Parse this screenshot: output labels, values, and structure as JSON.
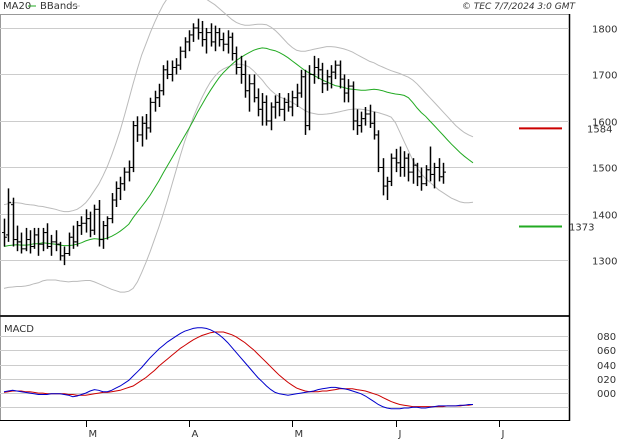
{
  "header": {
    "legend_ma": "MA20",
    "legend_bb": "BBands",
    "source_line": "© TEC 7/7/2024 3:0 GMT"
  },
  "colors": {
    "price_bar": "#000000",
    "ma": "#22aa22",
    "bbands": "#bbbbbb",
    "resistance": "#cc0000",
    "support": "#22aa22",
    "macd": "#0000cc",
    "signal": "#cc0000",
    "grid": "#cccccc"
  },
  "chart_data": [
    {
      "type": "ohlc",
      "title": "",
      "y_ticks": [
        1300,
        1400,
        1500,
        1600,
        1700,
        1800
      ],
      "y_range": [
        1215,
        1830
      ],
      "x_month_labels": [
        "M",
        "A",
        "M",
        "J",
        "J"
      ],
      "x_month_positions": [
        19,
        43,
        67,
        91,
        115
      ],
      "series_count": 120,
      "resistance_level": 1584,
      "support_level": 1373,
      "bars": [
        [
          1360,
          1390,
          1330,
          1350
        ],
        [
          1355,
          1455,
          1340,
          1425
        ],
        [
          1420,
          1435,
          1330,
          1345
        ],
        [
          1345,
          1375,
          1320,
          1340
        ],
        [
          1340,
          1360,
          1315,
          1325
        ],
        [
          1325,
          1370,
          1320,
          1345
        ],
        [
          1345,
          1365,
          1315,
          1330
        ],
        [
          1330,
          1370,
          1325,
          1355
        ],
        [
          1355,
          1370,
          1310,
          1335
        ],
        [
          1335,
          1370,
          1320,
          1360
        ],
        [
          1360,
          1380,
          1325,
          1330
        ],
        [
          1330,
          1355,
          1310,
          1340
        ],
        [
          1340,
          1365,
          1320,
          1335
        ],
        [
          1335,
          1340,
          1300,
          1310
        ],
        [
          1310,
          1330,
          1290,
          1315
        ],
        [
          1315,
          1360,
          1310,
          1350
        ],
        [
          1350,
          1375,
          1325,
          1340
        ],
        [
          1340,
          1385,
          1330,
          1375
        ],
        [
          1375,
          1395,
          1355,
          1380
        ],
        [
          1380,
          1410,
          1360,
          1390
        ],
        [
          1390,
          1405,
          1350,
          1365
        ],
        [
          1365,
          1420,
          1355,
          1410
        ],
        [
          1410,
          1430,
          1330,
          1345
        ],
        [
          1345,
          1385,
          1325,
          1375
        ],
        [
          1375,
          1395,
          1345,
          1390
        ],
        [
          1390,
          1445,
          1380,
          1430
        ],
        [
          1430,
          1470,
          1415,
          1455
        ],
        [
          1455,
          1480,
          1430,
          1465
        ],
        [
          1465,
          1500,
          1450,
          1490
        ],
        [
          1490,
          1515,
          1470,
          1500
        ],
        [
          1500,
          1600,
          1490,
          1590
        ],
        [
          1590,
          1610,
          1555,
          1570
        ],
        [
          1570,
          1610,
          1545,
          1595
        ],
        [
          1595,
          1615,
          1560,
          1585
        ],
        [
          1585,
          1650,
          1575,
          1640
        ],
        [
          1640,
          1665,
          1620,
          1650
        ],
        [
          1650,
          1680,
          1630,
          1665
        ],
        [
          1665,
          1720,
          1655,
          1710
        ],
        [
          1710,
          1730,
          1690,
          1700
        ],
        [
          1700,
          1730,
          1685,
          1715
        ],
        [
          1715,
          1735,
          1700,
          1720
        ],
        [
          1720,
          1760,
          1710,
          1750
        ],
        [
          1750,
          1780,
          1735,
          1770
        ],
        [
          1770,
          1795,
          1750,
          1785
        ],
        [
          1785,
          1810,
          1770,
          1800
        ],
        [
          1800,
          1820,
          1775,
          1790
        ],
        [
          1790,
          1815,
          1760,
          1775
        ],
        [
          1775,
          1800,
          1745,
          1790
        ],
        [
          1790,
          1810,
          1760,
          1770
        ],
        [
          1770,
          1805,
          1750,
          1790
        ],
        [
          1790,
          1800,
          1760,
          1775
        ],
        [
          1775,
          1790,
          1750,
          1765
        ],
        [
          1765,
          1795,
          1745,
          1780
        ],
        [
          1780,
          1790,
          1730,
          1745
        ],
        [
          1745,
          1760,
          1700,
          1715
        ],
        [
          1715,
          1740,
          1680,
          1700
        ],
        [
          1700,
          1730,
          1650,
          1665
        ],
        [
          1665,
          1700,
          1620,
          1680
        ],
        [
          1680,
          1700,
          1640,
          1650
        ],
        [
          1650,
          1670,
          1610,
          1625
        ],
        [
          1625,
          1660,
          1590,
          1640
        ],
        [
          1640,
          1655,
          1590,
          1600
        ],
        [
          1600,
          1640,
          1580,
          1630
        ],
        [
          1630,
          1655,
          1605,
          1640
        ],
        [
          1640,
          1660,
          1610,
          1625
        ],
        [
          1625,
          1650,
          1600,
          1640
        ],
        [
          1640,
          1660,
          1620,
          1630
        ],
        [
          1630,
          1665,
          1610,
          1650
        ],
        [
          1650,
          1680,
          1630,
          1660
        ],
        [
          1660,
          1710,
          1650,
          1695
        ],
        [
          1695,
          1710,
          1570,
          1590
        ],
        [
          1590,
          1720,
          1580,
          1700
        ],
        [
          1700,
          1740,
          1680,
          1715
        ],
        [
          1715,
          1735,
          1690,
          1710
        ],
        [
          1710,
          1725,
          1660,
          1680
        ],
        [
          1680,
          1710,
          1665,
          1695
        ],
        [
          1695,
          1720,
          1670,
          1705
        ],
        [
          1705,
          1730,
          1690,
          1720
        ],
        [
          1720,
          1730,
          1670,
          1690
        ],
        [
          1690,
          1700,
          1640,
          1660
        ],
        [
          1660,
          1690,
          1640,
          1675
        ],
        [
          1675,
          1685,
          1580,
          1600
        ],
        [
          1600,
          1625,
          1570,
          1590
        ],
        [
          1590,
          1620,
          1575,
          1605
        ],
        [
          1605,
          1630,
          1590,
          1615
        ],
        [
          1615,
          1635,
          1585,
          1595
        ],
        [
          1595,
          1620,
          1560,
          1570
        ],
        [
          1570,
          1580,
          1490,
          1500
        ],
        [
          1500,
          1520,
          1440,
          1460
        ],
        [
          1460,
          1480,
          1430,
          1470
        ],
        [
          1470,
          1530,
          1460,
          1520
        ],
        [
          1520,
          1540,
          1490,
          1510
        ],
        [
          1510,
          1545,
          1480,
          1500
        ],
        [
          1500,
          1535,
          1480,
          1520
        ],
        [
          1520,
          1530,
          1470,
          1490
        ],
        [
          1490,
          1520,
          1465,
          1505
        ],
        [
          1505,
          1510,
          1460,
          1480
        ],
        [
          1480,
          1500,
          1450,
          1465
        ],
        [
          1465,
          1505,
          1460,
          1495
        ],
        [
          1495,
          1545,
          1470,
          1485
        ],
        [
          1485,
          1510,
          1455,
          1500
        ],
        [
          1500,
          1520,
          1470,
          1480
        ],
        [
          1480,
          1510,
          1465,
          1490
        ]
      ],
      "ma20": [
        1330,
        1332,
        1333,
        1334,
        1333,
        1333,
        1334,
        1336,
        1336,
        1338,
        1337,
        1336,
        1335,
        1333,
        1332,
        1332,
        1333,
        1335,
        1338,
        1342,
        1345,
        1347,
        1346,
        1346,
        1348,
        1352,
        1357,
        1363,
        1370,
        1378,
        1392,
        1404,
        1416,
        1428,
        1441,
        1456,
        1471,
        1488,
        1504,
        1520,
        1536,
        1552,
        1568,
        1584,
        1601,
        1619,
        1635,
        1651,
        1666,
        1680,
        1693,
        1704,
        1713,
        1722,
        1730,
        1736,
        1742,
        1747,
        1752,
        1755,
        1757,
        1756,
        1753,
        1751,
        1747,
        1742,
        1736,
        1729,
        1722,
        1715,
        1708,
        1703,
        1698,
        1693,
        1688,
        1684,
        1680,
        1676,
        1674,
        1672,
        1669,
        1668,
        1667,
        1666,
        1666,
        1667,
        1668,
        1667,
        1665,
        1662,
        1660,
        1658,
        1657,
        1655,
        1650,
        1640,
        1628,
        1618,
        1610,
        1600,
        1590,
        1580,
        1570,
        1560,
        1550,
        1541,
        1532,
        1524,
        1517,
        1510
      ],
      "bb_upper": [
        1420,
        1422,
        1424,
        1424,
        1423,
        1421,
        1420,
        1419,
        1417,
        1416,
        1414,
        1412,
        1410,
        1407,
        1405,
        1405,
        1407,
        1410,
        1416,
        1424,
        1436,
        1450,
        1464,
        1482,
        1502,
        1526,
        1552,
        1580,
        1612,
        1646,
        1680,
        1712,
        1742,
        1766,
        1790,
        1812,
        1832,
        1850,
        1864,
        1876,
        1882,
        1884,
        1884,
        1882,
        1880,
        1876,
        1870,
        1862,
        1856,
        1850,
        1842,
        1834,
        1826,
        1818,
        1812,
        1808,
        1806,
        1806,
        1807,
        1808,
        1808,
        1807,
        1802,
        1795,
        1786,
        1776,
        1766,
        1758,
        1752,
        1750,
        1750,
        1752,
        1754,
        1756,
        1758,
        1760,
        1760,
        1759,
        1757,
        1755,
        1752,
        1748,
        1743,
        1738,
        1733,
        1728,
        1725,
        1720,
        1716,
        1712,
        1708,
        1705,
        1702,
        1698,
        1694,
        1688,
        1680,
        1670,
        1660,
        1650,
        1640,
        1630,
        1620,
        1610,
        1600,
        1590,
        1582,
        1575,
        1570,
        1566
      ],
      "bb_lower": [
        1240,
        1242,
        1243,
        1244,
        1244,
        1245,
        1247,
        1250,
        1252,
        1256,
        1258,
        1258,
        1258,
        1256,
        1255,
        1254,
        1255,
        1255,
        1256,
        1257,
        1257,
        1254,
        1250,
        1246,
        1242,
        1238,
        1235,
        1232,
        1232,
        1234,
        1240,
        1254,
        1274,
        1296,
        1320,
        1346,
        1372,
        1400,
        1430,
        1462,
        1494,
        1526,
        1556,
        1582,
        1608,
        1630,
        1650,
        1668,
        1684,
        1696,
        1706,
        1712,
        1716,
        1720,
        1722,
        1722,
        1720,
        1716,
        1708,
        1698,
        1688,
        1676,
        1666,
        1658,
        1652,
        1648,
        1644,
        1640,
        1634,
        1628,
        1622,
        1618,
        1616,
        1614,
        1614,
        1615,
        1616,
        1618,
        1620,
        1622,
        1624,
        1625,
        1626,
        1625,
        1624,
        1622,
        1620,
        1618,
        1615,
        1612,
        1608,
        1596,
        1576,
        1556,
        1536,
        1516,
        1500,
        1486,
        1476,
        1468,
        1460,
        1452,
        1446,
        1440,
        1434,
        1430,
        1426,
        1424,
        1424,
        1425
      ]
    },
    {
      "type": "line",
      "title": "MACD",
      "y_ticks": [
        -20,
        0,
        20,
        40,
        60,
        80
      ],
      "y_tick_labels": [
        "000",
        "020",
        "040",
        "060",
        "080"
      ],
      "y_range": [
        -35,
        100
      ],
      "series": [
        {
          "name": "",
          "values": [
            2,
            3,
            4,
            3,
            2,
            1,
            0,
            -1,
            -2,
            -2,
            -2,
            -1,
            -1,
            -1,
            -2,
            -3,
            -5,
            -4,
            -2,
            0,
            3,
            5,
            4,
            2,
            2,
            4,
            7,
            10,
            14,
            18,
            24,
            30,
            36,
            43,
            50,
            56,
            62,
            67,
            72,
            76,
            80,
            84,
            87,
            89,
            91,
            92,
            92,
            91,
            89,
            86,
            82,
            77,
            71,
            64,
            57,
            50,
            43,
            36,
            29,
            22,
            16,
            10,
            5,
            1,
            -1,
            -2,
            -3,
            -2,
            -1,
            0,
            1,
            2,
            3,
            5,
            6,
            7,
            8,
            8,
            7,
            6,
            5,
            3,
            1,
            -1,
            -4,
            -8,
            -12,
            -16,
            -19,
            -21,
            -22,
            -22,
            -22,
            -21,
            -21,
            -20,
            -20,
            -21,
            -21,
            -20,
            -19,
            -18,
            -18,
            -18,
            -18,
            -18,
            -17,
            -17,
            -16,
            -16
          ]
        },
        {
          "name": "",
          "values": [
            1,
            2,
            3,
            3,
            3,
            2,
            2,
            1,
            0,
            0,
            -1,
            -1,
            -1,
            -1,
            -1,
            -2,
            -2,
            -3,
            -3,
            -3,
            -2,
            -1,
            0,
            1,
            1,
            2,
            3,
            4,
            6,
            8,
            10,
            14,
            18,
            22,
            27,
            32,
            38,
            43,
            48,
            53,
            58,
            63,
            67,
            71,
            75,
            78,
            81,
            83,
            85,
            86,
            86,
            86,
            84,
            82,
            79,
            75,
            71,
            66,
            61,
            55,
            49,
            43,
            37,
            31,
            25,
            20,
            15,
            11,
            7,
            5,
            3,
            2,
            2,
            2,
            3,
            3,
            4,
            5,
            6,
            6,
            6,
            6,
            5,
            4,
            3,
            1,
            -1,
            -3,
            -6,
            -9,
            -12,
            -14,
            -16,
            -17,
            -18,
            -19,
            -19,
            -19,
            -19,
            -19,
            -19,
            -19,
            -19,
            -18,
            -18,
            -18,
            -18,
            -17,
            -17,
            -16
          ]
        }
      ]
    }
  ]
}
